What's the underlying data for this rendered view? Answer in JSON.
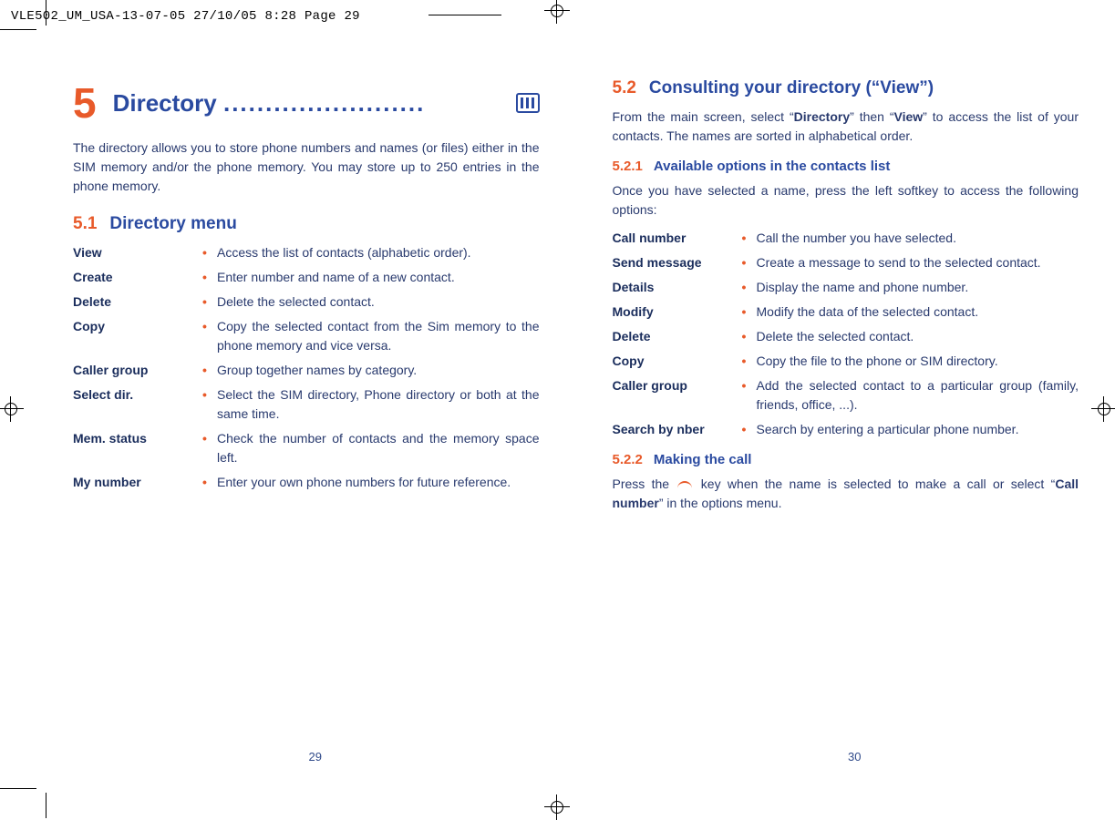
{
  "slug": "VLE502_UM_USA-13-07-05  27/10/05  8:28  Page 29",
  "left": {
    "pagenum": "29",
    "chapnum": "5",
    "chaptitle": "Directory",
    "dots": "........................",
    "intro": "The directory allows you to store phone numbers and names (or files) either in the SIM memory and/or the phone memory. You may store up to 250 entries in the phone memory.",
    "sec51_num": "5.1",
    "sec51_title": "Directory menu",
    "menu": [
      {
        "term": "View",
        "desc": "Access the list of contacts (alphabetic order)."
      },
      {
        "term": "Create",
        "desc": "Enter number and name of a new contact."
      },
      {
        "term": "Delete",
        "desc": "Delete the selected contact."
      },
      {
        "term": "Copy",
        "desc": "Copy the selected contact from the Sim memory to the phone memory and vice versa."
      },
      {
        "term": "Caller group",
        "desc": "Group together names by category."
      },
      {
        "term": "Select dir.",
        "desc": "Select the SIM directory, Phone directory or both at the same time."
      },
      {
        "term": "Mem. status",
        "desc": "Check the number of contacts and the memory space left."
      },
      {
        "term": "My number",
        "desc": "Enter your own phone numbers for future reference."
      }
    ]
  },
  "right": {
    "pagenum": "30",
    "sec52_num": "5.2",
    "sec52_title": "Consulting your directory (“View”)",
    "p52_pre": "From the main screen, select “",
    "p52_b1": "Directory",
    "p52_mid": "” then “",
    "p52_b2": "View",
    "p52_post": "” to access the list of your contacts. The names are sorted in alphabetical order.",
    "sub521_num": "5.2.1",
    "sub521_title": "Available options in the contacts list",
    "p521": "Once you have selected a name, press the left softkey to access the following options:",
    "options": [
      {
        "term": "Call number",
        "desc": "Call the number you have selected."
      },
      {
        "term": "Send message",
        "desc": "Create a message to send to the selected contact."
      },
      {
        "term": "Details",
        "desc": "Display the name and phone number."
      },
      {
        "term": "Modify",
        "desc": "Modify the data of the selected contact."
      },
      {
        "term": "Delete",
        "desc": "Delete the selected contact."
      },
      {
        "term": "Copy",
        "desc": "Copy the file to the phone or SIM directory."
      },
      {
        "term": "Caller group",
        "desc": "Add the selected contact to a particular group (family, friends, office, ...)."
      },
      {
        "term": "Search by nber",
        "desc": "Search by entering a particular phone number."
      }
    ],
    "sub522_num": "5.2.2",
    "sub522_title": "Making the call",
    "p522_pre": "Press the ",
    "p522_mid": " key when the name is selected to make a call or select “",
    "p522_b": "Call number",
    "p522_post": "” in the options menu."
  }
}
